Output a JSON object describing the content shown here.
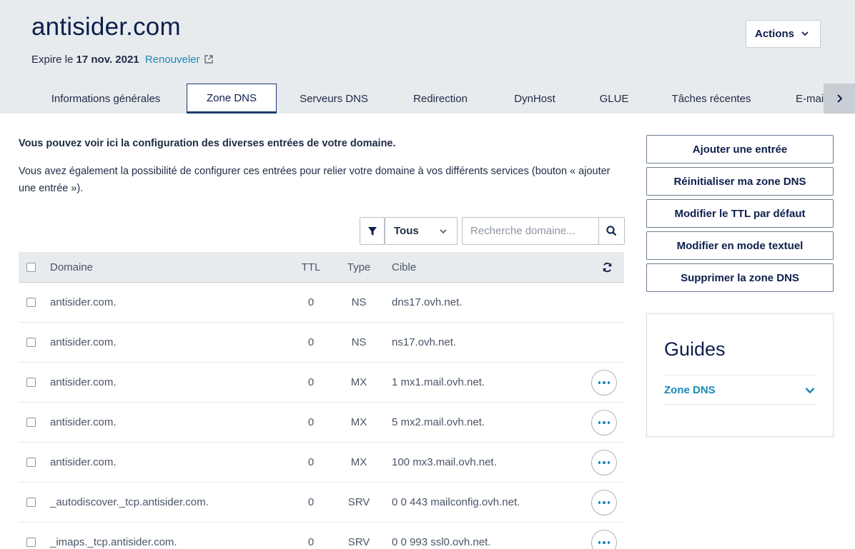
{
  "header": {
    "domain": "antisider.com",
    "expiry_prefix": "Expire le",
    "expiry_date": "17 nov. 2021",
    "renew_label": "Renouveler",
    "actions_label": "Actions"
  },
  "tabs": [
    {
      "label": "Informations générales",
      "active": false
    },
    {
      "label": "Zone DNS",
      "active": true
    },
    {
      "label": "Serveurs DNS",
      "active": false
    },
    {
      "label": "Redirection",
      "active": false
    },
    {
      "label": "DynHost",
      "active": false
    },
    {
      "label": "GLUE",
      "active": false
    },
    {
      "label": "Tâches récentes",
      "active": false
    },
    {
      "label": "E-mai",
      "active": false
    }
  ],
  "intro": {
    "bold": "Vous pouvez voir ici la configuration des diverses entrées de votre domaine.",
    "text": "Vous avez également la possibilité de configurer ces entrées pour relier votre domaine à vos différents services (bouton « ajouter une entrée »)."
  },
  "filter": {
    "type_value": "Tous",
    "search_placeholder": "Recherche domaine..."
  },
  "table": {
    "columns": {
      "domain": "Domaine",
      "ttl": "TTL",
      "type": "Type",
      "target": "Cible"
    },
    "rows": [
      {
        "domain": "antisider.com.",
        "ttl": "0",
        "type": "NS",
        "target": "dns17.ovh.net.",
        "menu": false
      },
      {
        "domain": "antisider.com.",
        "ttl": "0",
        "type": "NS",
        "target": "ns17.ovh.net.",
        "menu": false
      },
      {
        "domain": "antisider.com.",
        "ttl": "0",
        "type": "MX",
        "target": "1 mx1.mail.ovh.net.",
        "menu": true
      },
      {
        "domain": "antisider.com.",
        "ttl": "0",
        "type": "MX",
        "target": "5 mx2.mail.ovh.net.",
        "menu": true
      },
      {
        "domain": "antisider.com.",
        "ttl": "0",
        "type": "MX",
        "target": "100 mx3.mail.ovh.net.",
        "menu": true
      },
      {
        "domain": "_autodiscover._tcp.antisider.com.",
        "ttl": "0",
        "type": "SRV",
        "target": "0 0 443 mailconfig.ovh.net.",
        "menu": true
      },
      {
        "domain": "_imaps._tcp.antisider.com.",
        "ttl": "0",
        "type": "SRV",
        "target": "0 0 993 ssl0.ovh.net.",
        "menu": true
      }
    ]
  },
  "side_actions": [
    "Ajouter une entrée",
    "Réinitialiser ma zone DNS",
    "Modifier le TTL par défaut",
    "Modifier en mode textuel",
    "Supprimer la zone DNS"
  ],
  "guides": {
    "title": "Guides",
    "item": "Zone DNS"
  },
  "colors": {
    "header_bg": "#e8ebee",
    "link": "#1a88b8",
    "title": "#0d1f4b",
    "active_tab_border": "#1a3c6e"
  }
}
